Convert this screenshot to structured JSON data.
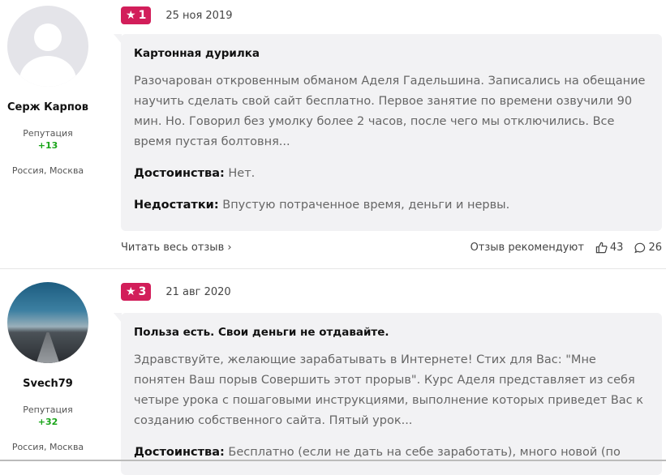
{
  "reviews": [
    {
      "user": {
        "name": "Серж Карпов",
        "reputation_label": "Репутация",
        "reputation": "+13",
        "location": "Россия, Москва"
      },
      "rating": "1",
      "date": "25 ноя 2019",
      "title": "Картонная дурилка",
      "text": "Разочарован откровенным обманом Аделя Гадельшина. Записались на обещание научить сделать свой сайт бесплатно. Первое занятие по времени озвучили 90 мин. Но. Говорил без умолку более 2 часов, после чего мы отключились. Все время пустая болтовня...",
      "pros_label": "Достоинства:",
      "pros": "Нет.",
      "cons_label": "Недостатки:",
      "cons": "Впустую потраченное время, деньги и нервы.",
      "read_more": "Читать весь отзыв",
      "recommend": "Отзыв рекомендуют",
      "likes": "43",
      "comments": "26"
    },
    {
      "user": {
        "name": "Svech79",
        "reputation_label": "Репутация",
        "reputation": "+32",
        "location": "Россия, Москва"
      },
      "rating": "3",
      "date": "21 авг 2020",
      "title": "Польза есть. Свои деньги не отдавайте.",
      "text": "Здравствуйте, желающие зарабатывать в Интернете! Стих для Вас: \"Мне понятен Ваш порыв Совершить этот прорыв\". Курс Аделя представляет из себя четыре урока с пошаговыми инструкциями, выполнение которых приведет Вас к созданию собственного сайта. Пятый урок...",
      "pros_label": "Достоинства:",
      "pros": "Бесплатно (если не дать на себе заработать), много новой (по"
    }
  ],
  "colors": {
    "badge": "#d21e5a",
    "reputation": "#1aa51a"
  }
}
